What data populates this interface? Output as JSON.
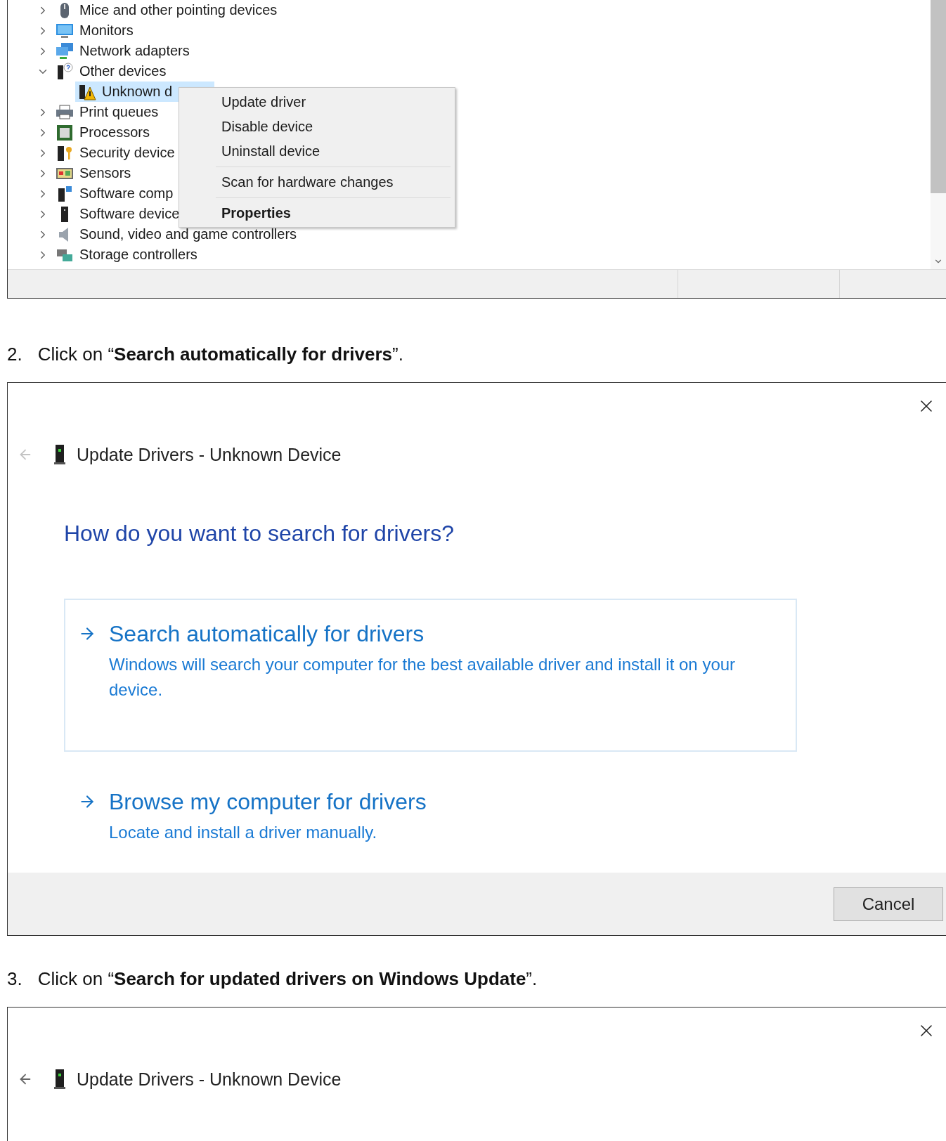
{
  "device_manager": {
    "tree": [
      {
        "label": "Mice and other pointing devices",
        "kind": "mouse",
        "expanded": false,
        "selected": false
      },
      {
        "label": "Monitors",
        "kind": "monitor",
        "expanded": false,
        "selected": false
      },
      {
        "label": "Network adapters",
        "kind": "network",
        "expanded": false,
        "selected": false
      },
      {
        "label": "Other devices",
        "kind": "other",
        "expanded": true,
        "selected": false,
        "children": [
          {
            "label": "Unknown d",
            "kind": "unknown",
            "selected": true
          }
        ]
      },
      {
        "label": "Print queues",
        "kind": "printer",
        "expanded": false,
        "selected": false
      },
      {
        "label": "Processors",
        "kind": "processor",
        "expanded": false,
        "selected": false
      },
      {
        "label": "Security device",
        "kind": "security",
        "expanded": false,
        "selected": false
      },
      {
        "label": "Sensors",
        "kind": "sensor",
        "expanded": false,
        "selected": false
      },
      {
        "label": "Software comp",
        "kind": "component",
        "expanded": false,
        "selected": false
      },
      {
        "label": "Software device",
        "kind": "device",
        "expanded": false,
        "selected": false
      },
      {
        "label": "Sound, video and game controllers",
        "kind": "sound",
        "expanded": false,
        "selected": false
      },
      {
        "label": "Storage controllers",
        "kind": "storage",
        "expanded": false,
        "selected": false
      }
    ],
    "context_menu": [
      {
        "kind": "item",
        "label": "Update driver"
      },
      {
        "kind": "item",
        "label": "Disable device"
      },
      {
        "kind": "item",
        "label": "Uninstall device"
      },
      {
        "kind": "separator"
      },
      {
        "kind": "item",
        "label": "Scan for hardware changes"
      },
      {
        "kind": "separator"
      },
      {
        "kind": "default",
        "label": "Properties"
      }
    ]
  },
  "steps": [
    {
      "number": "2.",
      "instruction": "Click on “**Search automatically for drivers**”.",
      "dialog": {
        "title": "Update Drivers - Unknown Device",
        "back_enabled": false,
        "heading": "How do you want to search for drivers?",
        "options": [
          {
            "title": "Search automatically for drivers",
            "description": "Windows will search your computer for the best available driver and install it on your device.",
            "selected": true
          },
          {
            "title": "Browse my computer for drivers",
            "description": "Locate and install a driver manually.",
            "selected": false
          }
        ],
        "button": "Cancel"
      }
    },
    {
      "number": "3.",
      "instruction": "Click on “**Search for updated drivers on Windows Update**”.",
      "dialog": {
        "title": "Update Drivers - Unknown Device",
        "back_enabled": true
      }
    }
  ]
}
